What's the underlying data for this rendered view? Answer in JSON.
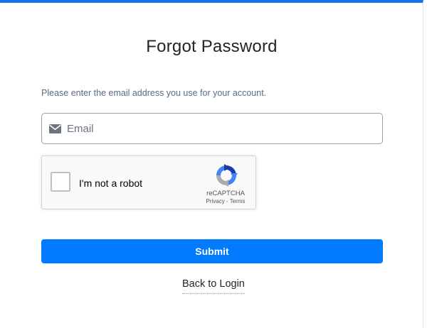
{
  "page": {
    "title": "Forgot Password",
    "instructions": "Please enter the email address you use for your account.",
    "accent_color": "#1a73e8"
  },
  "email_field": {
    "placeholder": "Email",
    "value": "",
    "icon": "envelope-icon"
  },
  "recaptcha": {
    "label": "I'm not a robot",
    "brand": "reCAPTCHA",
    "privacy_link": "Privacy",
    "separator": " - ",
    "terms_link": "Terms",
    "checked": false,
    "icon": "recaptcha-logo-icon"
  },
  "submit": {
    "label": "Submit",
    "color": "#007bff"
  },
  "back_link": {
    "label": "Back to Login"
  }
}
